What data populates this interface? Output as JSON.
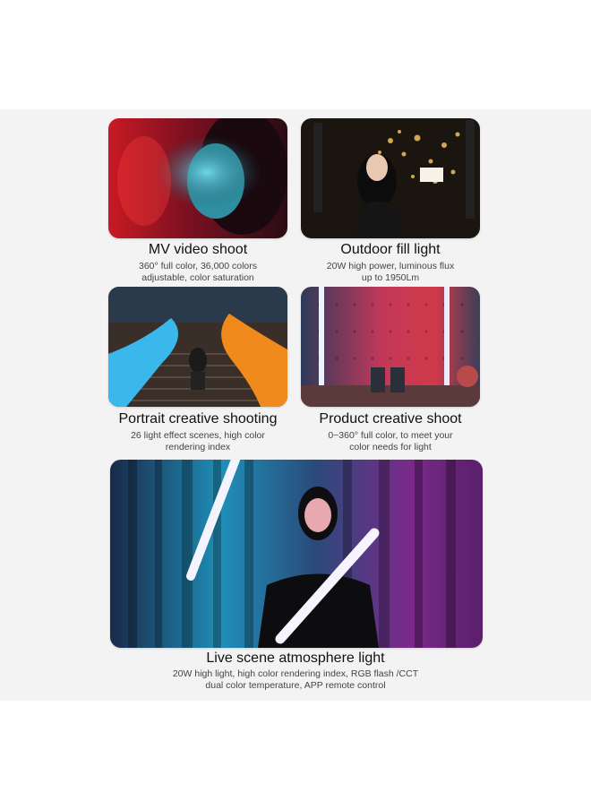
{
  "cards": [
    {
      "image": "woman lit by red and cyan light",
      "title": "MV video shoot",
      "desc": [
        "360° full color, 36,000 colors",
        "adjustable, color saturation"
      ]
    },
    {
      "image": "woman holding light outdoors at night with bokeh",
      "title": "Outdoor fill light",
      "desc": [
        "20W high power, luminous flux",
        "up to 1950Lm"
      ]
    },
    {
      "image": "person sitting on stairs between cyan and orange light trails",
      "title": "Portrait creative shooting",
      "desc": [
        "26 light effect scenes, high color",
        "rendering index"
      ]
    },
    {
      "image": "product table with red and blue light tubes",
      "title": "Product creative shoot",
      "desc": [
        "0~360° full color, to meet your",
        "color needs for light"
      ]
    },
    {
      "image": "woman holding two light tubes in front of colored curtains",
      "title": "Live scene atmosphere light",
      "desc": [
        "20W high light, high color rendering index, RGB flash /CCT",
        "dual color temperature, APP remote control"
      ]
    }
  ]
}
